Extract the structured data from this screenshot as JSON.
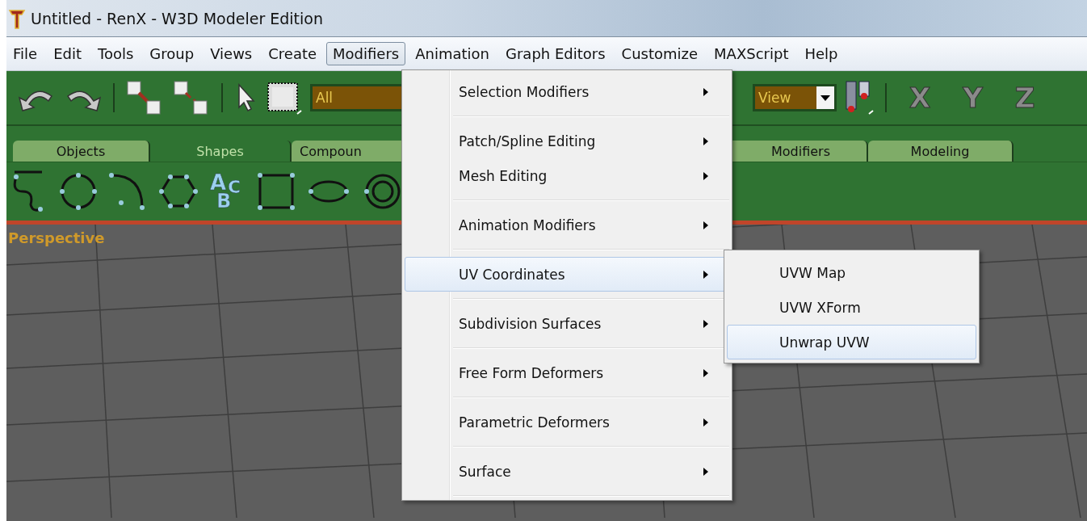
{
  "window": {
    "title": "Untitled - RenX - W3D Modeler Edition"
  },
  "menu_bar": [
    {
      "label": "File",
      "selected": false
    },
    {
      "label": "Edit",
      "selected": false
    },
    {
      "label": "Tools",
      "selected": false
    },
    {
      "label": "Group",
      "selected": false
    },
    {
      "label": "Views",
      "selected": false
    },
    {
      "label": "Create",
      "selected": false
    },
    {
      "label": "Modifiers",
      "selected": true
    },
    {
      "label": "Animation",
      "selected": false
    },
    {
      "label": "Graph Editors",
      "selected": false
    },
    {
      "label": "Customize",
      "selected": false
    },
    {
      "label": "MAXScript",
      "selected": false
    },
    {
      "label": "Help",
      "selected": false
    }
  ],
  "toolbar": {
    "selection_filter": "All",
    "coordinate_system": "View",
    "axis_buttons": [
      {
        "label": "X"
      },
      {
        "label": "Y"
      },
      {
        "label": "Z"
      }
    ]
  },
  "command_tabs": [
    {
      "label": "Objects",
      "selected": false
    },
    {
      "label": "Shapes",
      "selected": true
    },
    {
      "label": "Compoun",
      "selected": false
    },
    {
      "label": "Modifiers",
      "selected": false
    },
    {
      "label": "Modeling",
      "selected": false
    }
  ],
  "shape_tools": [
    {
      "kind": "line"
    },
    {
      "kind": "circle"
    },
    {
      "kind": "arc"
    },
    {
      "kind": "ngon"
    },
    {
      "kind": "text",
      "letters": [
        "A",
        "B",
        "C"
      ]
    },
    {
      "kind": "rectangle"
    },
    {
      "kind": "ellipse"
    },
    {
      "kind": "donut"
    }
  ],
  "viewport": {
    "label": "Perspective"
  },
  "modifiers_menu": [
    {
      "label": "Selection Modifiers",
      "selected": false,
      "has_submenu": true,
      "separator_after": true
    },
    {
      "label": "Patch/Spline Editing",
      "selected": false,
      "has_submenu": true,
      "separator_after": false
    },
    {
      "label": "Mesh Editing",
      "selected": false,
      "has_submenu": true,
      "separator_after": true
    },
    {
      "label": "Animation Modifiers",
      "selected": false,
      "has_submenu": true,
      "separator_after": true
    },
    {
      "label": "UV Coordinates",
      "selected": true,
      "has_submenu": true,
      "separator_after": true
    },
    {
      "label": "Subdivision Surfaces",
      "selected": false,
      "has_submenu": true,
      "separator_after": true
    },
    {
      "label": "Free Form Deformers",
      "selected": false,
      "has_submenu": true,
      "separator_after": true
    },
    {
      "label": "Parametric Deformers",
      "selected": false,
      "has_submenu": true,
      "separator_after": true
    },
    {
      "label": "Surface",
      "selected": false,
      "has_submenu": true,
      "separator_after": true
    }
  ],
  "uv_submenu": [
    {
      "label": "UVW Map",
      "selected": false
    },
    {
      "label": "UVW XForm",
      "selected": false
    },
    {
      "label": "Unwrap UVW",
      "selected": true
    }
  ]
}
